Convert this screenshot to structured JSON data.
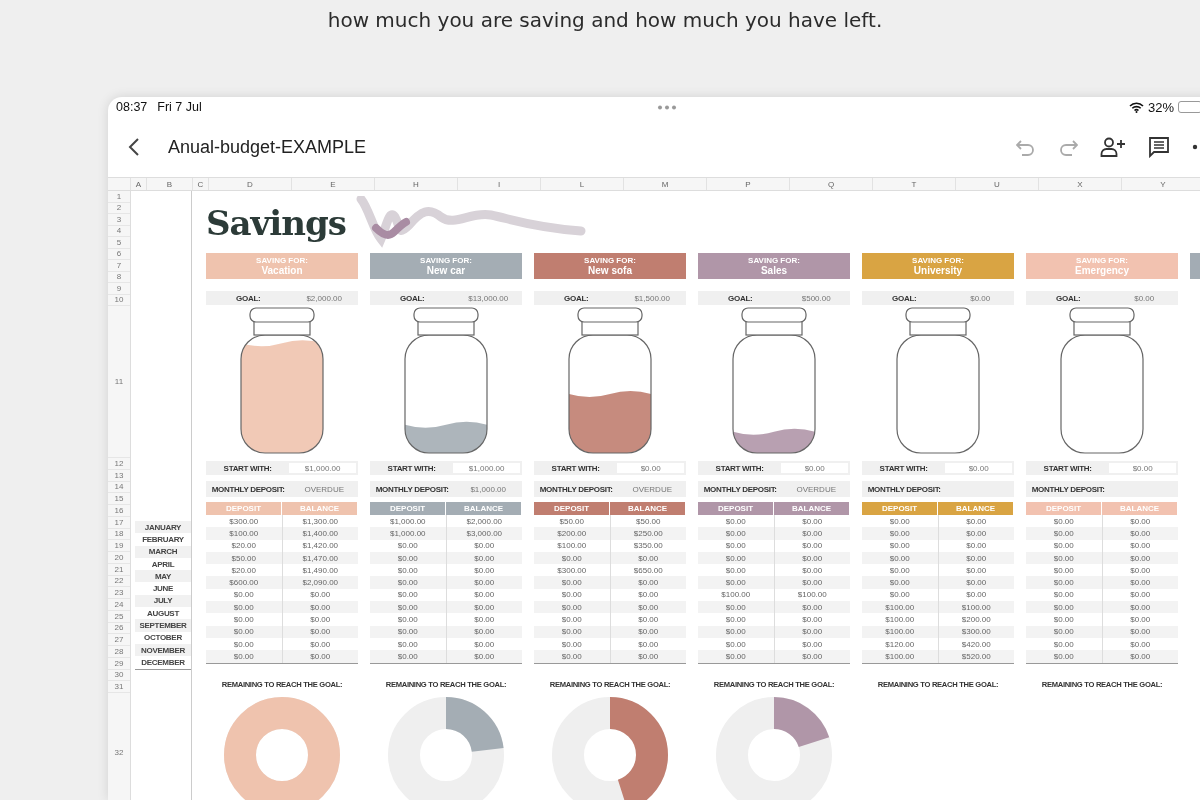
{
  "caption": "how much you are saving and how much you have left.",
  "status_bar": {
    "time": "08:37",
    "date": "Fri 7 Jul",
    "battery": "32%"
  },
  "toolbar": {
    "title": "Anual-budget-EXAMPLE"
  },
  "sheet": {
    "column_headers": [
      "A",
      "B",
      "C",
      "D",
      "E",
      "H",
      "I",
      "L",
      "M",
      "P",
      "Q",
      "T",
      "U",
      "X",
      "Y"
    ],
    "row_numbers": [
      "1",
      "2",
      "3",
      "4",
      "5",
      "6",
      "7",
      "8",
      "9",
      "10",
      "11",
      "12",
      "13",
      "14",
      "15",
      "16",
      "17",
      "18",
      "19",
      "20",
      "21",
      "22",
      "23",
      "24",
      "25",
      "26",
      "27",
      "28",
      "29",
      "30",
      "31",
      "32"
    ],
    "title": "Savings",
    "months": [
      "JANUARY",
      "FEBRUARY",
      "MARCH",
      "APRIL",
      "MAY",
      "JUNE",
      "JULY",
      "AUGUST",
      "SEPTEMBER",
      "OCTOBER",
      "NOVEMBER",
      "DECEMBER"
    ],
    "cards": [
      {
        "color": "#efc3ae",
        "saving_for_label": "SAVING FOR:",
        "name": "Vacation",
        "goal_label": "GOAL:",
        "goal": "$2,000.00",
        "jar": {
          "level": 0.93
        },
        "start_label": "START WITH:",
        "start": "$1,000.00",
        "monthly_label": "MONTHLY DEPOSIT:",
        "monthly": "OVERDUE",
        "columns": [
          "DEPOSIT",
          "BALANCE"
        ],
        "rows": [
          [
            "$300.00",
            "$1,300.00"
          ],
          [
            "$100.00",
            "$1,400.00"
          ],
          [
            "$20.00",
            "$1,420.00"
          ],
          [
            "$50.00",
            "$1,470.00"
          ],
          [
            "$20.00",
            "$1,490.00"
          ],
          [
            "$600.00",
            "$2,090.00"
          ],
          [
            "$0.00",
            "$0.00"
          ],
          [
            "$0.00",
            "$0.00"
          ],
          [
            "$0.00",
            "$0.00"
          ],
          [
            "$0.00",
            "$0.00"
          ],
          [
            "$0.00",
            "$0.00"
          ],
          [
            "$0.00",
            "$0.00"
          ]
        ],
        "remaining_label": "REMAINING TO REACH THE GOAL:",
        "donut": {
          "level": 1
        }
      },
      {
        "color": "#a4adb4",
        "saving_for_label": "SAVING FOR:",
        "name": "New car",
        "goal_label": "GOAL:",
        "goal": "$13,000.00",
        "jar": {
          "level": 0.24
        },
        "start_label": "START WITH:",
        "start": "$1,000.00",
        "monthly_label": "MONTHLY DEPOSIT:",
        "monthly": "$1,000.00",
        "columns": [
          "DEPOSIT",
          "BALANCE"
        ],
        "rows": [
          [
            "$1,000.00",
            "$2,000.00"
          ],
          [
            "$1,000.00",
            "$3,000.00"
          ],
          [
            "$0.00",
            "$0.00"
          ],
          [
            "$0.00",
            "$0.00"
          ],
          [
            "$0.00",
            "$0.00"
          ],
          [
            "$0.00",
            "$0.00"
          ],
          [
            "$0.00",
            "$0.00"
          ],
          [
            "$0.00",
            "$0.00"
          ],
          [
            "$0.00",
            "$0.00"
          ],
          [
            "$0.00",
            "$0.00"
          ],
          [
            "$0.00",
            "$0.00"
          ],
          [
            "$0.00",
            "$0.00"
          ]
        ],
        "remaining_label": "REMAINING TO REACH THE GOAL:",
        "donut": {
          "level": 0.23
        }
      },
      {
        "color": "#c07e70",
        "saving_for_label": "SAVING FOR:",
        "name": "New sofa",
        "goal_label": "GOAL:",
        "goal": "$1,500.00",
        "jar": {
          "level": 0.5
        },
        "start_label": "START WITH:",
        "start": "$0.00",
        "monthly_label": "MONTHLY DEPOSIT:",
        "monthly": "OVERDUE",
        "columns": [
          "DEPOSIT",
          "BALANCE"
        ],
        "rows": [
          [
            "$50.00",
            "$50.00"
          ],
          [
            "$200.00",
            "$250.00"
          ],
          [
            "$100.00",
            "$350.00"
          ],
          [
            "$0.00",
            "$0.00"
          ],
          [
            "$300.00",
            "$650.00"
          ],
          [
            "$0.00",
            "$0.00"
          ],
          [
            "$0.00",
            "$0.00"
          ],
          [
            "$0.00",
            "$0.00"
          ],
          [
            "$0.00",
            "$0.00"
          ],
          [
            "$0.00",
            "$0.00"
          ],
          [
            "$0.00",
            "$0.00"
          ],
          [
            "$0.00",
            "$0.00"
          ]
        ],
        "remaining_label": "REMAINING TO REACH THE GOAL:",
        "donut": {
          "level": 0.45
        }
      },
      {
        "color": "#b096a8",
        "saving_for_label": "SAVING FOR:",
        "name": "Sales",
        "goal_label": "GOAL:",
        "goal": "$500.00",
        "jar": {
          "level": 0.18
        },
        "start_label": "START WITH:",
        "start": "$0.00",
        "monthly_label": "MONTHLY DEPOSIT:",
        "monthly": "OVERDUE",
        "columns": [
          "DEPOSIT",
          "BALANCE"
        ],
        "rows": [
          [
            "$0.00",
            "$0.00"
          ],
          [
            "$0.00",
            "$0.00"
          ],
          [
            "$0.00",
            "$0.00"
          ],
          [
            "$0.00",
            "$0.00"
          ],
          [
            "$0.00",
            "$0.00"
          ],
          [
            "$0.00",
            "$0.00"
          ],
          [
            "$100.00",
            "$100.00"
          ],
          [
            "$0.00",
            "$0.00"
          ],
          [
            "$0.00",
            "$0.00"
          ],
          [
            "$0.00",
            "$0.00"
          ],
          [
            "$0.00",
            "$0.00"
          ],
          [
            "$0.00",
            "$0.00"
          ]
        ],
        "remaining_label": "REMAINING TO REACH THE GOAL:",
        "donut": {
          "level": 0.2
        }
      },
      {
        "color": "#d9a443",
        "saving_for_label": "SAVING FOR:",
        "name": "University",
        "goal_label": "GOAL:",
        "goal": "$0.00",
        "start_label": "START WITH:",
        "start": "$0.00",
        "monthly_label": "MONTHLY DEPOSIT:",
        "columns": [
          "DEPOSIT",
          "BALANCE"
        ],
        "rows": [
          [
            "$0.00",
            "$0.00"
          ],
          [
            "$0.00",
            "$0.00"
          ],
          [
            "$0.00",
            "$0.00"
          ],
          [
            "$0.00",
            "$0.00"
          ],
          [
            "$0.00",
            "$0.00"
          ],
          [
            "$0.00",
            "$0.00"
          ],
          [
            "$0.00",
            "$0.00"
          ],
          [
            "$100.00",
            "$100.00"
          ],
          [
            "$100.00",
            "$200.00"
          ],
          [
            "$100.00",
            "$300.00"
          ],
          [
            "$120.00",
            "$420.00"
          ],
          [
            "$100.00",
            "$520.00"
          ]
        ],
        "remaining_label": "REMAINING TO REACH THE GOAL:"
      },
      {
        "color": "#f2c2b0",
        "saving_for_label": "SAVING FOR:",
        "name": "Emergency",
        "goal_label": "GOAL:",
        "goal": "$0.00",
        "start_label": "START WITH:",
        "start": "$0.00",
        "monthly_label": "MONTHLY DEPOSIT:",
        "columns": [
          "DEPOSIT",
          "BALANCE"
        ],
        "rows": [
          [
            "$0.00",
            "$0.00"
          ],
          [
            "$0.00",
            "$0.00"
          ],
          [
            "$0.00",
            "$0.00"
          ],
          [
            "$0.00",
            "$0.00"
          ],
          [
            "$0.00",
            "$0.00"
          ],
          [
            "$0.00",
            "$0.00"
          ],
          [
            "$0.00",
            "$0.00"
          ],
          [
            "$0.00",
            "$0.00"
          ],
          [
            "$0.00",
            "$0.00"
          ],
          [
            "$0.00",
            "$0.00"
          ],
          [
            "$0.00",
            "$0.00"
          ],
          [
            "$0.00",
            "$0.00"
          ]
        ],
        "remaining_label": "REMAINING TO REACH THE GOAL:"
      },
      {
        "color": "#a3acb4"
      }
    ]
  }
}
